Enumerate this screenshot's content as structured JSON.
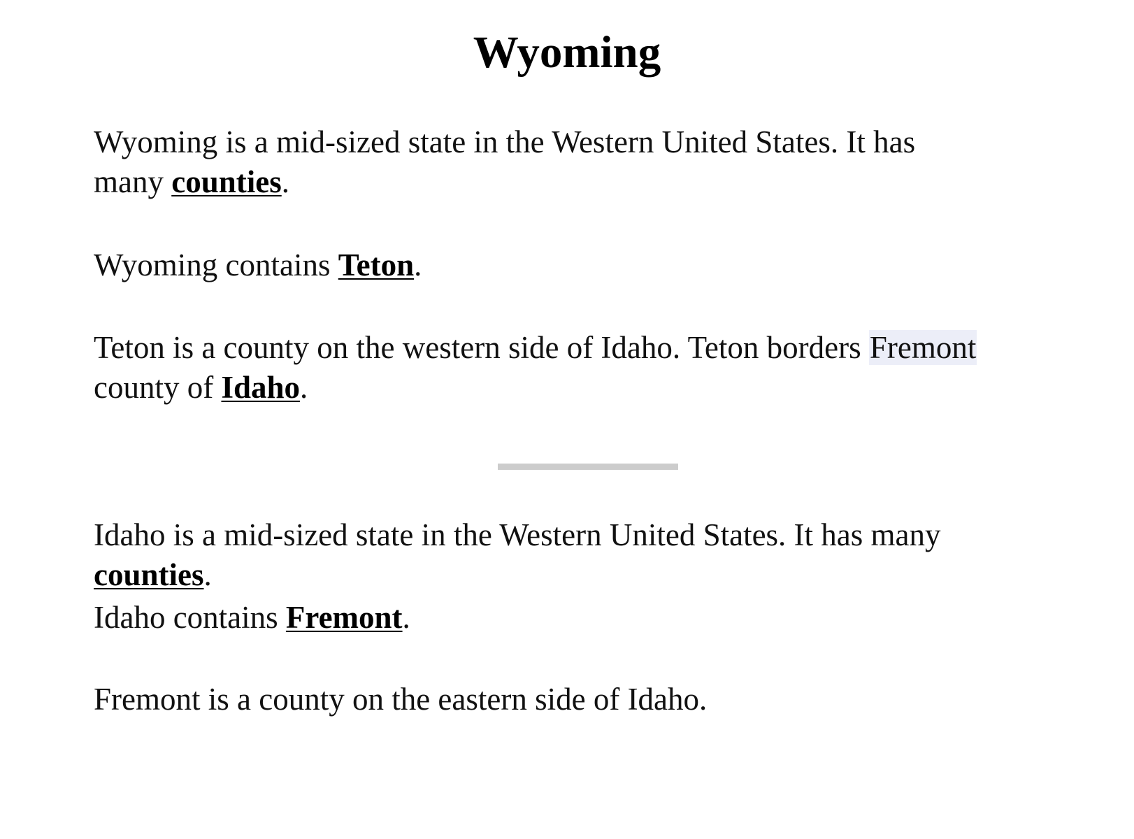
{
  "article": {
    "title": "Wyoming",
    "section1": {
      "p1": {
        "text": "Wyoming is a mid-sized state in the Western United States. It has many ",
        "link": "counties",
        "end": "."
      },
      "p2": {
        "text": "Wyoming contains ",
        "link": "Teton",
        "end": "."
      },
      "p3": {
        "text_a": "Teton is a county on the western side of Idaho. Teton borders ",
        "highlight": "Fremont",
        "text_b": " county of ",
        "link": "Idaho",
        "end": "."
      }
    },
    "section2": {
      "p1": {
        "text": "Idaho is a mid-sized state in the Western United States. It has many ",
        "link": "counties",
        "end": "."
      },
      "p2": {
        "text": "Idaho contains ",
        "link": "Fremont",
        "end": "."
      },
      "p3": {
        "text": "Fremont is a county on the eastern side of Idaho."
      }
    }
  }
}
